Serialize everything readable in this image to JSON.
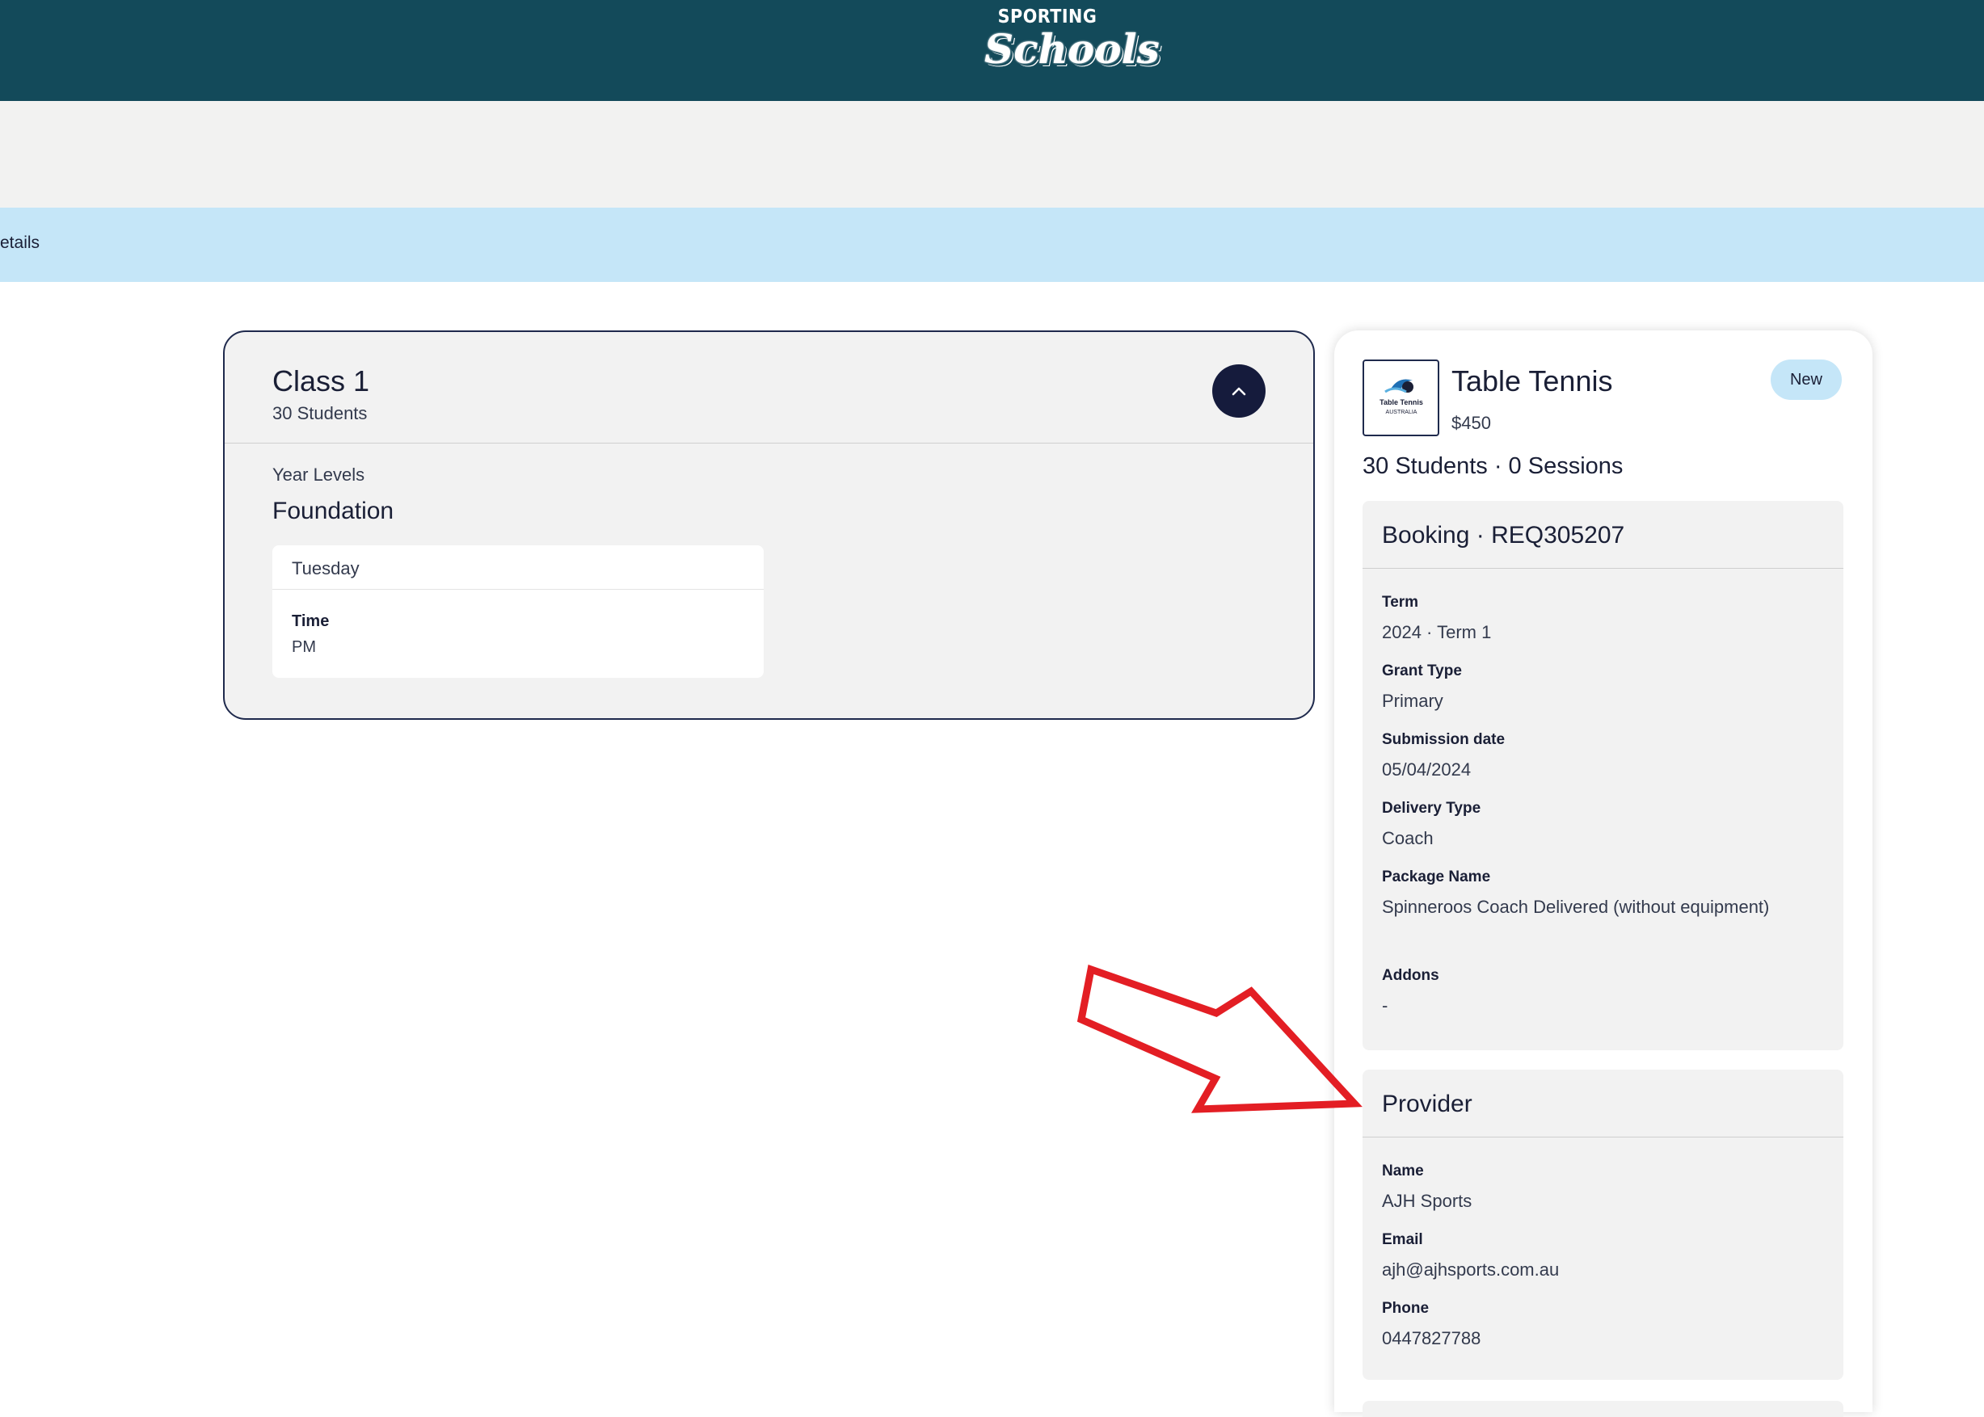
{
  "header": {
    "logo_small": "SPORTING",
    "logo_big": "Schools",
    "colors": {
      "bar": "#134a5a",
      "band": "#c5e6f8"
    }
  },
  "breadcrumb": {
    "current": "etails"
  },
  "class": {
    "title": "Class 1",
    "students": "30 Students",
    "collapse_icon": "chevron-up-icon",
    "year_levels_label": "Year Levels",
    "year_levels_value": "Foundation",
    "schedule": {
      "day": "Tuesday",
      "time_label": "Time",
      "time_value": "PM"
    }
  },
  "summary": {
    "logo_text_line1": "Table Tennis",
    "logo_text_line2": "AUSTRALIA",
    "sport": "Table Tennis",
    "price": "$450",
    "badge": "New",
    "stats": "30 Students · 0 Sessions",
    "booking": {
      "title": "Booking · REQ305207",
      "fields": [
        {
          "label": "Term",
          "value": "2024 · Term 1"
        },
        {
          "label": "Grant Type",
          "value": "Primary"
        },
        {
          "label": "Submission date",
          "value": "05/04/2024"
        },
        {
          "label": "Delivery Type",
          "value": "Coach"
        },
        {
          "label": "Package Name",
          "value": "Spinneroos Coach Delivered (without equipment)"
        },
        {
          "label": "Addons",
          "value": "-"
        }
      ]
    },
    "provider": {
      "title": "Provider",
      "fields": [
        {
          "label": "Name",
          "value": "AJH Sports"
        },
        {
          "label": "Email",
          "value": "ajh@ajhsports.com.au"
        },
        {
          "label": "Phone",
          "value": "0447827788"
        }
      ]
    }
  },
  "annotation": {
    "type": "red-arrow",
    "color": "#e31e24"
  }
}
